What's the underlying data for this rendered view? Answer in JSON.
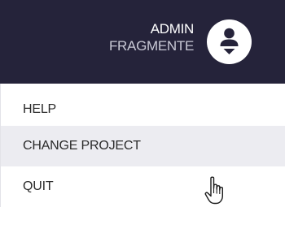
{
  "header": {
    "user_name": "ADMIN",
    "project_name": "FRAGMENTE",
    "avatar_icon": "user-avatar-icon",
    "background_color": "#25233a"
  },
  "menu": {
    "items": [
      {
        "label": "HELP"
      },
      {
        "label": "CHANGE PROJECT"
      },
      {
        "label": "QUIT"
      }
    ],
    "hovered_item": "CHANGE PROJECT"
  },
  "cursor": {
    "icon": "hand-pointer-icon"
  }
}
